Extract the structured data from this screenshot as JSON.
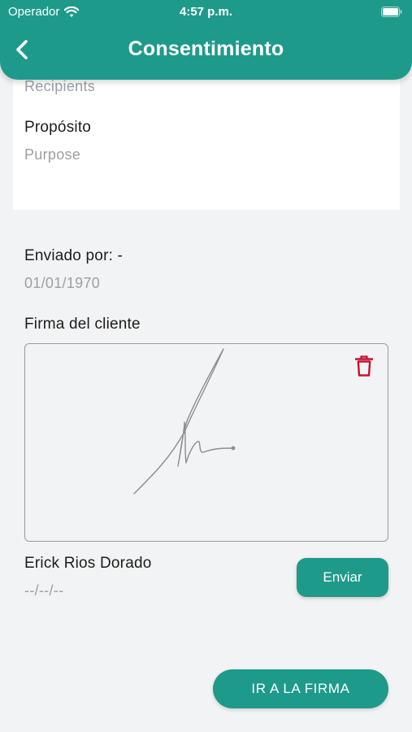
{
  "status_bar": {
    "carrier": "Operador",
    "time": "4:57 p.m."
  },
  "nav": {
    "title": "Consentimiento",
    "back_icon": "chevron-left-icon"
  },
  "card": {
    "recipients_value": "Recipients",
    "purpose_label": "Propósito",
    "purpose_value": "Purpose"
  },
  "sent_by": {
    "label": "Enviado por: -",
    "date": "01/01/1970"
  },
  "signature": {
    "label": "Firma del cliente",
    "delete_icon": "trash-icon"
  },
  "client": {
    "name": "Erick Rios Dorado",
    "date": "--/--/--"
  },
  "buttons": {
    "send": "Enviar",
    "go_to_sign": "IR A LA FIRMA"
  },
  "colors": {
    "primary": "#1e9a8a",
    "delete": "#c8102e",
    "muted_text": "#9aa0a6"
  }
}
